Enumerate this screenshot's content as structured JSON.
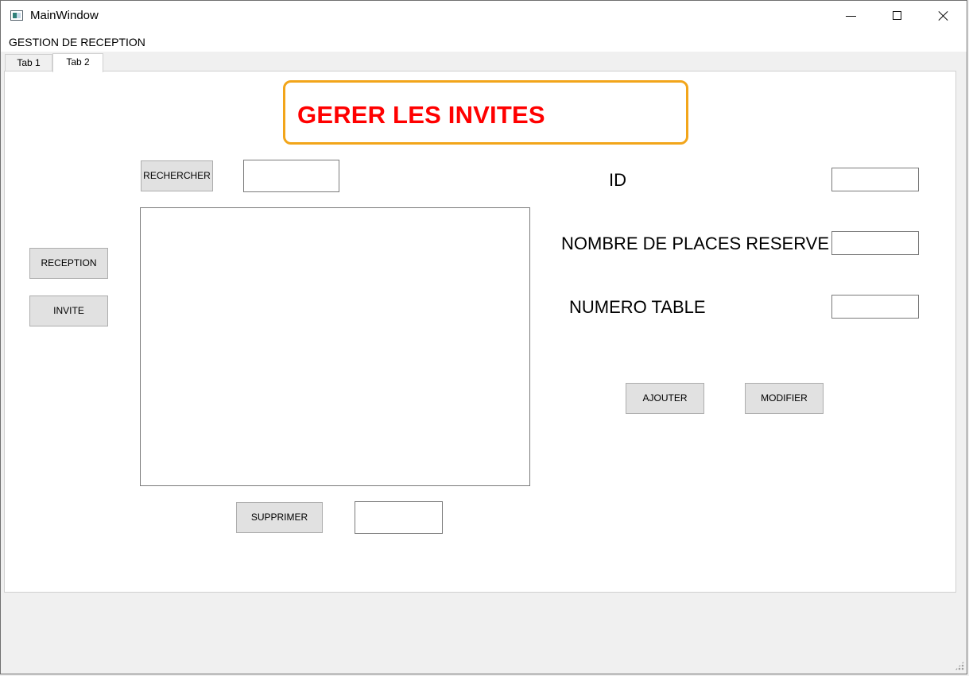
{
  "window": {
    "title": "MainWindow",
    "icon": "app-window-icon",
    "controls": {
      "minimize": "minimize-icon",
      "maximize": "maximize-icon",
      "close": "close-icon"
    }
  },
  "menu": {
    "title": "GESTION DE RECEPTION"
  },
  "tabs": [
    {
      "label": "Tab 1",
      "selected": false
    },
    {
      "label": "Tab 2",
      "selected": true
    }
  ],
  "page": {
    "header": "GERER LES INVITES",
    "sidebar": {
      "reception_label": "RECEPTION",
      "invite_label": "INVITE"
    },
    "search": {
      "button_label": "RECHERCHER",
      "value": "",
      "placeholder": ""
    },
    "list": {
      "items": []
    },
    "delete": {
      "button_label": "SUPPRIMER",
      "value": "",
      "placeholder": ""
    },
    "form": {
      "id_label": "ID",
      "id_value": "",
      "places_label": "NOMBRE DE PLACES RESERVE",
      "places_value": "",
      "table_label": "NUMERO TABLE",
      "table_value": "",
      "add_label": "AJOUTER",
      "modify_label": "MODIFIER"
    }
  },
  "colors": {
    "header_text": "#ff0000",
    "header_border": "#f2a51a",
    "button_background": "#e1e1e1",
    "window_background": "#f0f0f0"
  }
}
